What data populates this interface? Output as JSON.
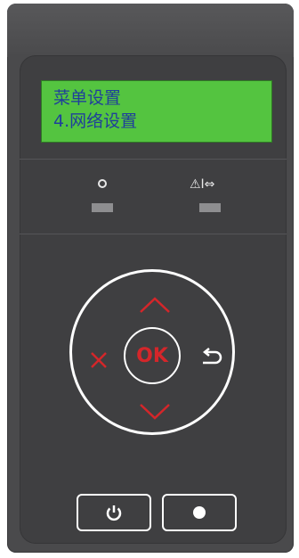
{
  "lcd": {
    "line1": "菜单设置",
    "line2": "4.网络设置"
  },
  "indicators": {
    "ready_label_icon": "circle-icon",
    "status_label": "⚠I⇔"
  },
  "dial": {
    "ok_label": "OK",
    "up_icon": "chevron-up-icon",
    "down_icon": "chevron-down-icon",
    "cancel_icon": "x-icon",
    "back_icon": "return-arrow-icon"
  },
  "buttons": {
    "power_icon": "power-icon",
    "dot_icon": "dot-icon"
  },
  "colors": {
    "panel": "#4a4a4c",
    "lcd": "#54c440",
    "lcd_text": "#1f3f9a",
    "accent_red": "#d4262a"
  }
}
